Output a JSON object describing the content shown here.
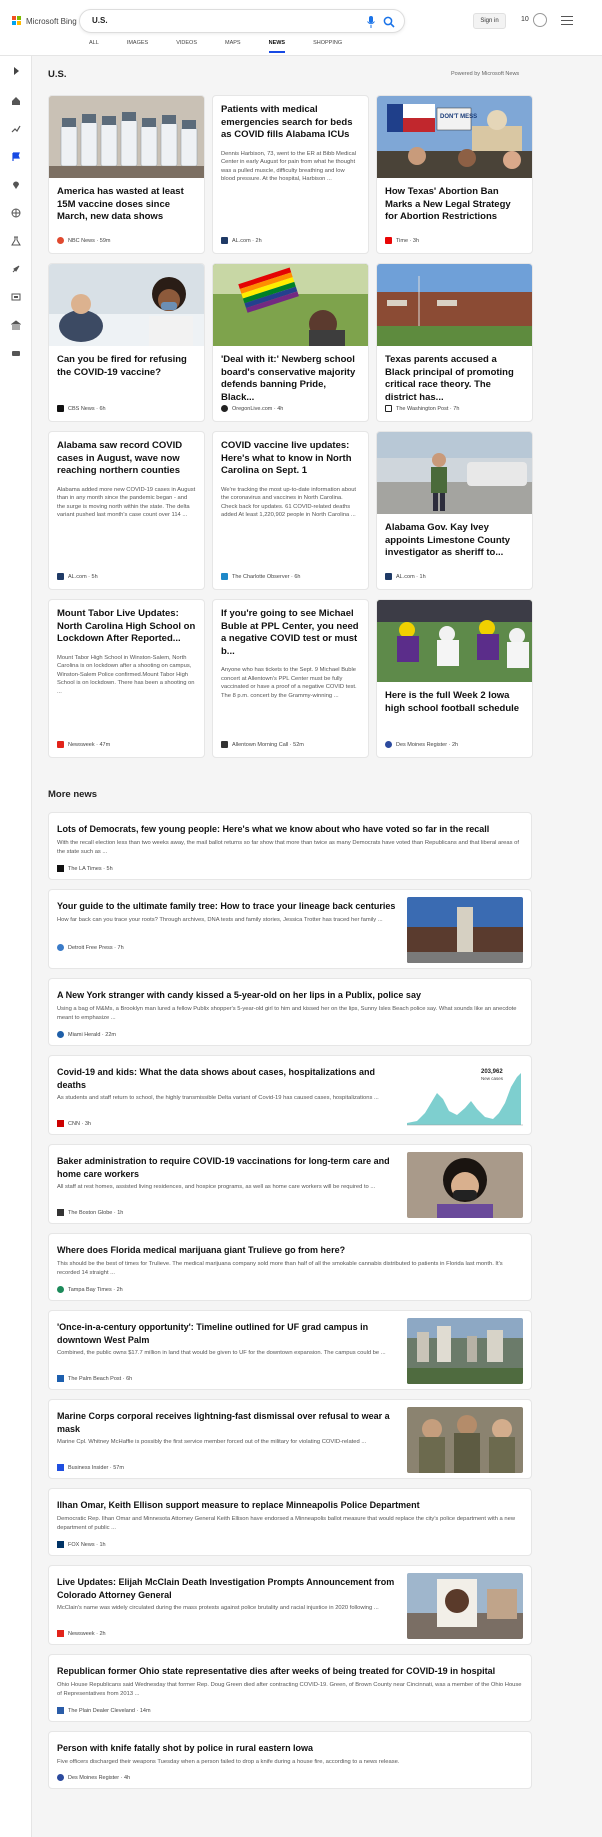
{
  "header": {
    "brand": "Microsoft Bing",
    "query": "U.S.",
    "signin": "Sign in",
    "points": "10",
    "tabs": [
      "ALL",
      "IMAGES",
      "VIDEOS",
      "MAPS",
      "NEWS",
      "SHOPPING"
    ],
    "active_tab": "NEWS"
  },
  "section": {
    "title": "U.S.",
    "powered_by": "Powered by Microsoft News"
  },
  "cards": [
    {
      "title": "America has wasted at least 15M vaccine doses since March, new data shows",
      "snippet": "",
      "source": "NBC News",
      "age": "59m"
    },
    {
      "title": "Patients with medical emergencies search for beds as COVID fills Alabama ICUs",
      "snippet": "Dennis Harbison, 73, went to the ER at Bibb Medical Center in early August for pain from what he thought was a pulled muscle, difficulty breathing and low blood pressure. At the hospital, Harbison ...",
      "source": "AL.com",
      "age": "2h"
    },
    {
      "title": "How Texas' Abortion Ban Marks a New Legal Strategy for Abortion Restrictions",
      "snippet": "",
      "source": "Time",
      "age": "3h"
    },
    {
      "title": "Can you be fired for refusing the COVID-19 vaccine?",
      "snippet": "",
      "source": "CBS News",
      "age": "6h"
    },
    {
      "title": "'Deal with it:' Newberg school board's conservative majority defends banning Pride, Black...",
      "snippet": "",
      "source": "OregonLive.com",
      "age": "4h"
    },
    {
      "title": "Texas parents accused a Black principal of promoting critical race theory. The district has...",
      "snippet": "",
      "source": "The Washington Post",
      "age": "7h"
    },
    {
      "title": "Alabama saw record COVID cases in August, wave now reaching northern counties",
      "snippet": "Alabama added more new COVID-19 cases in August than in any month since the pandemic began - and the surge is moving north within the state. The delta variant pushed last month's case count over 114 ...",
      "source": "AL.com",
      "age": "5h"
    },
    {
      "title": "COVID vaccine live updates: Here's what to know in North Carolina on Sept. 1",
      "snippet": "We're tracking the most up-to-date information about the coronavirus and vaccines in North Carolina. Check back for updates. 61 COVID-related deaths added At least 1,220,902 people in North Carolina ...",
      "source": "The Charlotte Observer",
      "age": "6h"
    },
    {
      "title": "Alabama Gov. Kay Ivey appoints Limestone County investigator as sheriff to...",
      "snippet": "",
      "source": "AL.com",
      "age": "1h"
    },
    {
      "title": "Mount Tabor Live Updates: North Carolina High School on Lockdown After Reported...",
      "snippet": "Mount Tabor High School in Winston-Salem, North Carolina is on lockdown after a shooting on campus, Winston-Salem Police confirmed.Mount Tabor High School is on lockdown. There has been a shooting on ...",
      "source": "Newsweek",
      "age": "47m"
    },
    {
      "title": "If you're going to see Michael Buble at PPL Center, you need a negative COVID test or must b...",
      "snippet": "Anyone who has tickets to the Sept. 9 Michael Buble concert at Allentown's PPL Center must be fully vaccinated or have a proof of a negative COVID test. The 8 p.m. concert by the Grammy-winning ...",
      "source": "Allentown Morning Call",
      "age": "52m"
    },
    {
      "title": "Here is the full Week 2 Iowa high school football schedule",
      "snippet": "",
      "source": "Des Moines Register",
      "age": "2h"
    }
  ],
  "more_news": {
    "title": "More news",
    "items": [
      {
        "title": "Lots of Democrats, few young people: Here's what we know about who have voted so far in the recall",
        "snippet": "With the recall election less than two weeks away, the mail ballot returns so far show that more than twice as many Democrats have voted than Republicans and that liberal areas of the state such as ...",
        "source": "The LA Times",
        "age": "5h"
      },
      {
        "title": "Your guide to the ultimate family tree: How to trace your lineage back centuries",
        "snippet": "How far back can you trace your roots? Through archives, DNA tests and family stories, Jessica Trotter has traced her family ...",
        "source": "Detroit Free Press",
        "age": "7h"
      },
      {
        "title": "A New York stranger with candy kissed a 5-year-old on her lips in a Publix, police say",
        "snippet": "Using a bag of M&Ms, a Brooklyn man lured a fellow Publix shopper's 5-year-old girl to him and kissed her on the lips, Sunny Isles Beach police say. What sounds like an anecdote meant to emphasize ...",
        "source": "Miami Herald",
        "age": "22m"
      },
      {
        "title": "Covid-19 and kids: What the data shows about cases, hospitalizations and deaths",
        "snippet": "As students and staff return to school, the highly transmissible Delta variant of Covid-19 has caused cases, hospitalizations ...",
        "source": "CNN",
        "age": "3h",
        "thumb_value": "203,962",
        "thumb_caption": "New cases"
      },
      {
        "title": "Baker administration to require COVID-19 vaccinations for long-term care and home care workers",
        "snippet": "All staff at rest homes, assisted living residences, and hospice programs, as well as home care workers will be required to ...",
        "source": "The Boston Globe",
        "age": "1h"
      },
      {
        "title": "Where does Florida medical marijuana giant Trulieve go from here?",
        "snippet": "This should be the best of times for Trulieve. The medical marijuana company sold more than half of all the smokable cannabis distributed to patients in Florida last month. It's recorded 14 straight ...",
        "source": "Tampa Bay Times",
        "age": "2h"
      },
      {
        "title": "'Once-in-a-century opportunity': Timeline outlined for UF grad campus in downtown West Palm",
        "snippet": "Combined, the public owns $17.7 million in land that would be given to UF for the downtown expansion. The campus could be ...",
        "source": "The Palm Beach Post",
        "age": "6h"
      },
      {
        "title": "Marine Corps corporal receives lightning-fast dismissal over refusal to wear a mask",
        "snippet": "Marine Cpl. Whitney McHaffie is possibly the first service member forced out of the military for violating COVID-related ...",
        "source": "Business Insider",
        "age": "57m"
      },
      {
        "title": "Ilhan Omar, Keith Ellison support measure to replace Minneapolis Police Department",
        "snippet": "Democratic Rep. Ilhan Omar and Minnesota Attorney General Keith Ellison have endorsed a Minneapolis ballot measure that would replace the city's police department with a new department of public ...",
        "source": "FOX News",
        "age": "1h"
      },
      {
        "title": "Live Updates: Elijah McClain Death Investigation Prompts Announcement from Colorado Attorney General",
        "snippet": "McClain's name was widely circulated during the mass protests against police brutality and racial injustice in 2020 following ...",
        "source": "Newsweek",
        "age": "2h"
      },
      {
        "title": "Republican former Ohio state representative dies after weeks of being treated for COVID-19 in hospital",
        "snippet": "Ohio House Republicans said Wednesday that former Rep. Doug Green died after contracting COVID-19. Green, of Brown County near Cincinnati, was a member of the Ohio House of Representatives from 2013 ...",
        "source": "The Plain Dealer Cleveland",
        "age": "14m"
      },
      {
        "title": "Person with knife fatally shot by police in rural eastern Iowa",
        "snippet": "Five officers discharged their weapons Tuesday when a person failed to drop a knife during a house fire, according to a news release.",
        "source": "Des Moines Register",
        "age": "4h"
      }
    ]
  },
  "colors": {
    "accent": "#174ae4",
    "bg": "#f5f5f5"
  }
}
